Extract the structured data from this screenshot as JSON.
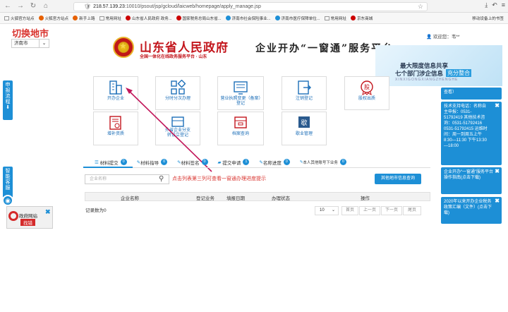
{
  "browser": {
    "url_host": "218.57.139.23",
    "url_path": ":10010/psout/jsp/gcloud/laicweb/homepage/apply_manage.jsp"
  },
  "bookmarks": [
    {
      "label": "火狐官方站点",
      "icon": "folder-icon"
    },
    {
      "label": "火狐官方站点",
      "icon": "firefox-icon"
    },
    {
      "label": "新手上路",
      "icon": "firefox-icon"
    },
    {
      "label": "常用网址",
      "icon": "folder-icon"
    },
    {
      "label": "山东省人民政府 政务...",
      "icon": "site-icon"
    },
    {
      "label": "国家税务总局山东省...",
      "icon": "site-icon"
    },
    {
      "label": "济南市社会保险事业...",
      "icon": "site-icon"
    },
    {
      "label": "济南市医疗保障单位...",
      "icon": "site-icon"
    },
    {
      "label": "常用网址",
      "icon": "folder-icon"
    },
    {
      "label": "京东商城",
      "icon": "site-icon"
    }
  ],
  "bookmarks_right": "移动设备上的书签",
  "header": {
    "switch_city": "切换地市",
    "city": "济南市",
    "gov_title": "山东省人民政府",
    "gov_subtitle": "全国一体化在线政务服务平台 · 山东",
    "slogan": "企业开办“一窗通”服务平台",
    "welcome": "欢迎您：韦**"
  },
  "banner": {
    "line1": "最大限度信息共享",
    "line2": "七个部门涉企信息",
    "badge": "充分整合",
    "pinyin": "XINXIGONGXIANGZHENGHE"
  },
  "left_tabs": {
    "declare": "申报流程",
    "smart": "智能客服"
  },
  "gov_site": {
    "line1": "政府网站",
    "line2": "找错"
  },
  "services": [
    {
      "label": "开办企业",
      "icon": "building-icon"
    },
    {
      "label": "分时分次办理",
      "icon": "grid-icon"
    },
    {
      "label": "营业执照变更（备案）登记",
      "icon": "license-icon"
    },
    {
      "label": "注销登记",
      "icon": "logout-doc-icon"
    },
    {
      "label": "股权出质",
      "icon": "stock-badge-icon"
    },
    {
      "label": "增补资质",
      "icon": "certificate-icon"
    },
    {
      "label": "外省企业分支转设立登记",
      "icon": "branch-icon"
    },
    {
      "label": "档案查询",
      "icon": "archive-icon"
    },
    {
      "label": "歇业管理",
      "icon": "suspend-icon"
    }
  ],
  "tabs": [
    {
      "label": "材料提交",
      "count": "0",
      "icon": "list-icon"
    },
    {
      "label": "材料指导",
      "count": "0",
      "icon": "edit-icon"
    },
    {
      "label": "材料签名",
      "count": "0",
      "icon": "edit-icon"
    },
    {
      "label": "提交申请",
      "count": "1",
      "icon": "briefcase-icon"
    },
    {
      "label": "名称进度",
      "count": "0",
      "icon": "edit-icon"
    },
    {
      "label": "本人其他账号下业务",
      "count": "0",
      "icon": "edit-icon"
    }
  ],
  "search": {
    "placeholder": "企业名称"
  },
  "hint": "点击列表第三列可查看一窗通办理进度提示",
  "query_button": "其他地市信息查询",
  "table": {
    "columns": [
      "企业名称",
      "登记业务",
      "填报日期",
      "办理状态",
      "操作"
    ],
    "records": "记录数为0"
  },
  "pagination": {
    "page_size": "10",
    "first": "首页",
    "prev": "上一页",
    "next": "下一页",
    "last": "尾页"
  },
  "right_cards": [
    {
      "text": "查看）"
    },
    {
      "text": "技术支持电话：名称自主申报：0531-51792419 其他技术咨询：0531-51792416 0531-51792415 运维时间：周一到周五上午8:30—11:30 下午13:30—18:00"
    },
    {
      "text": "企业开办“一窗通”服务平台操作指南(点击下载)"
    },
    {
      "text": "2020年以来开办企业税务政策汇编（文件）(点击下载)"
    }
  ],
  "colors": {
    "accent": "#1d8fd6",
    "brand_red": "#c3151c",
    "hint_red": "#d9332e"
  }
}
